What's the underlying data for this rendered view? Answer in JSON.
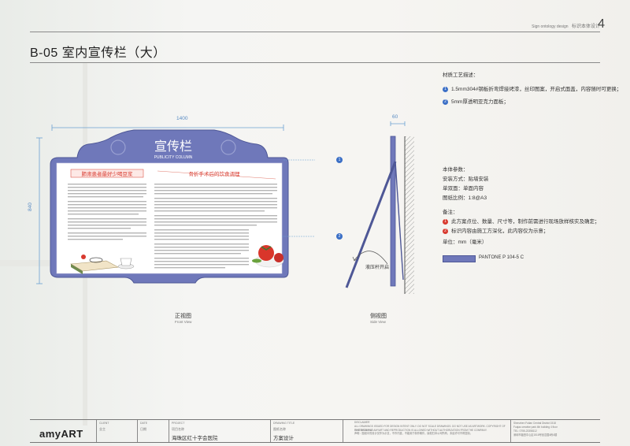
{
  "header": {
    "top_caption_en": "Sign ontology design",
    "top_caption_cn": "标识本体设计",
    "page_number": "4",
    "title": "B-05 室内宣传栏（大）"
  },
  "front_view": {
    "width_dim": "1400",
    "height_dim": "840",
    "banner_cn": "宣传栏",
    "banner_en": "PUBLICITY COLUMN",
    "col1_heading": "肺肃患者最好少喝豆浆",
    "col2_heading": "骨折手术后的饮食调理",
    "caption_cn": "正视图",
    "caption_en": "Front View",
    "marker1": "1",
    "marker2": "2"
  },
  "side_view": {
    "depth_dim": "60",
    "strut_label": "液压杆开启",
    "caption_cn": "侧视图",
    "caption_en": "Side View"
  },
  "materials": {
    "heading": "材质工艺描述：",
    "items": [
      {
        "num": "1",
        "text": "1.5mm304#钢板折弯焊接烤漆，丝印图案，开启式面盖，内容随时可更换；"
      },
      {
        "num": "2",
        "text": "5mm厚透明亚克力面板；"
      }
    ]
  },
  "params": {
    "heading": "本体参数：",
    "install": "安装方式：贴墙安装",
    "content": "单双面：单面内容",
    "scale": "图纸比例：1:8@A3"
  },
  "notes": {
    "heading": "备注：",
    "items": [
      {
        "num": "1",
        "text": "此方案点位、数量、尺寸等，制作前需进行现场放样核实及确定；"
      },
      {
        "num": "2",
        "text": "标识内容由施工方深化，此内容仅为示意；"
      }
    ],
    "unit": "单位：mm（毫米）"
  },
  "pantone": "PANTONE P 104-5 C",
  "colors": {
    "panel": "#6f78ba",
    "accent_red": "#d83a2f",
    "marker_blue": "#3b6fc6"
  },
  "footer": {
    "logo": "amyART",
    "client_label": "CLIENT",
    "client_value": "业主",
    "date_label": "DATE",
    "date_value": "日期",
    "project_label": "PROJECT",
    "project_value": "项目名称",
    "project_name": "海珠区红十字会医院",
    "drawing_label": "DRAWING TITLE",
    "drawing_value": "图纸名称",
    "drawing_name": "方案设计",
    "disclaimer_label": "DISCLAIMER",
    "disclaimer_1": "ALL DRAWINGS ISSUED FOR DESIGN INTENT ONLY. DO NOT SCALE DRAWINGS. DO NOT USE AS ARTWORK. COPYRIGHT OF THIS DRAWING",
    "disclaimer_2": "IS STRICTLY AT AMYART AND REPRODUCTION IS ALLOWED WITHOUT AUTHORIZATION FROM THE COMPANY.",
    "disclaimer_3": "声明：图纸中的设计仅作为示意，不作尺度，不能用于制作稿件，版权归本公司所有，未经许可不得复制。",
    "address_1": "Shenzhen Futian Central District 1518",
    "address_2": "Fuqiao creative park 4th building 4 floor",
    "address_3": "TEL: 0755-23358112",
    "address_4": "深圳市福田中心区1518号创意园4栋4楼"
  }
}
